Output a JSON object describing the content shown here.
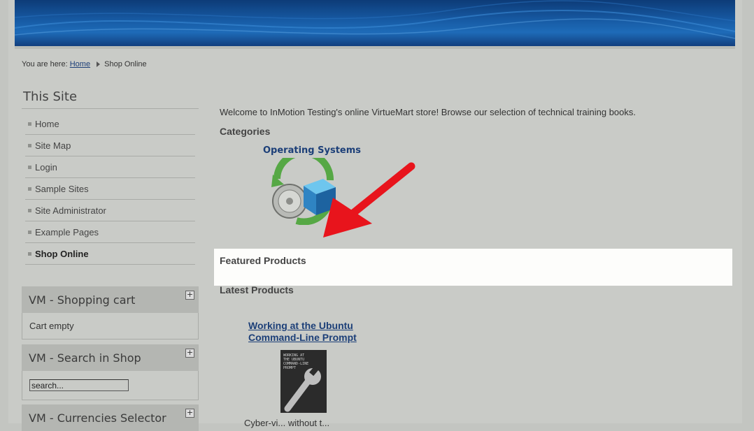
{
  "breadcrumb": {
    "prefix": "You are here:",
    "home": "Home",
    "current": "Shop Online"
  },
  "sidebar": {
    "heading": "This Site",
    "items": [
      {
        "label": "Home"
      },
      {
        "label": "Site Map"
      },
      {
        "label": "Login"
      },
      {
        "label": "Sample Sites"
      },
      {
        "label": "Site Administrator"
      },
      {
        "label": "Example Pages"
      },
      {
        "label": "Shop Online",
        "active": true
      }
    ]
  },
  "modules": {
    "cart": {
      "title": "VM - Shopping cart",
      "toggle": "+",
      "body": "Cart empty"
    },
    "search": {
      "title": "VM - Search in Shop",
      "toggle": "+",
      "value": "search..."
    },
    "currency": {
      "title": "VM - Currencies Selector",
      "toggle": "+"
    }
  },
  "main": {
    "welcome": "Welcome to InMotion Testing's online VirtueMart store! Browse our selection of technical training books.",
    "categories_heading": "Categories",
    "category": {
      "name": "Operating Systems",
      "icon": "os-category-icon"
    },
    "featured_heading": "Featured Products",
    "latest_heading": "Latest Products",
    "product": {
      "title_line1": "Working at the Ubuntu",
      "title_line2": "Command-Line Prompt",
      "cover_text": "WORKING AT\nTHE UBUNTU\nCOMMAND-LINE\nPROMPT",
      "desc": "Cyber-vi... without t..."
    }
  },
  "colors": {
    "page_bg": "#c9cbc7",
    "link": "#1c3f78",
    "highlight": "#fdfdfb",
    "annotation_arrow": "#e8141c"
  }
}
